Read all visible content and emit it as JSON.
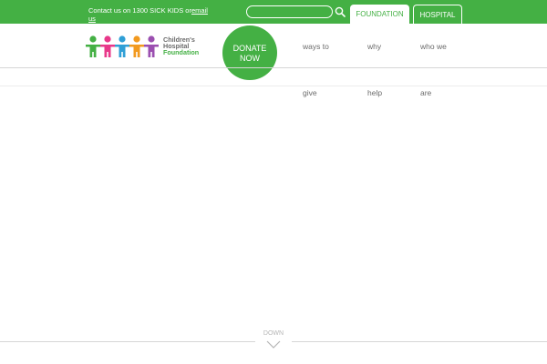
{
  "topbar": {
    "contact_prefix": "Contact us on 1300 SICK KIDS or",
    "contact_link": "email us",
    "search": {
      "placeholder": "",
      "value": "",
      "icon": "search-icon"
    },
    "tabs": [
      {
        "label": "FOUNDATION",
        "active": true
      },
      {
        "label": "HOSPITAL",
        "active": false
      }
    ],
    "accent_color": "#44b044"
  },
  "logo": {
    "line1": "Children's",
    "line2": "Hospital",
    "line3": "Foundation",
    "figure_colors": [
      "#44b044",
      "#e8388a",
      "#2f9fd6",
      "#f29a1f",
      "#9b4fb0"
    ]
  },
  "donate": {
    "line1": "DONATE",
    "line2": "NOW"
  },
  "nav": [
    {
      "top": "ways to",
      "bottom": "give"
    },
    {
      "top": "why",
      "bottom": "help"
    },
    {
      "top": "who we",
      "bottom": "are"
    }
  ],
  "scroll": {
    "label": "DOWN",
    "icon": "chevron-down-icon"
  }
}
